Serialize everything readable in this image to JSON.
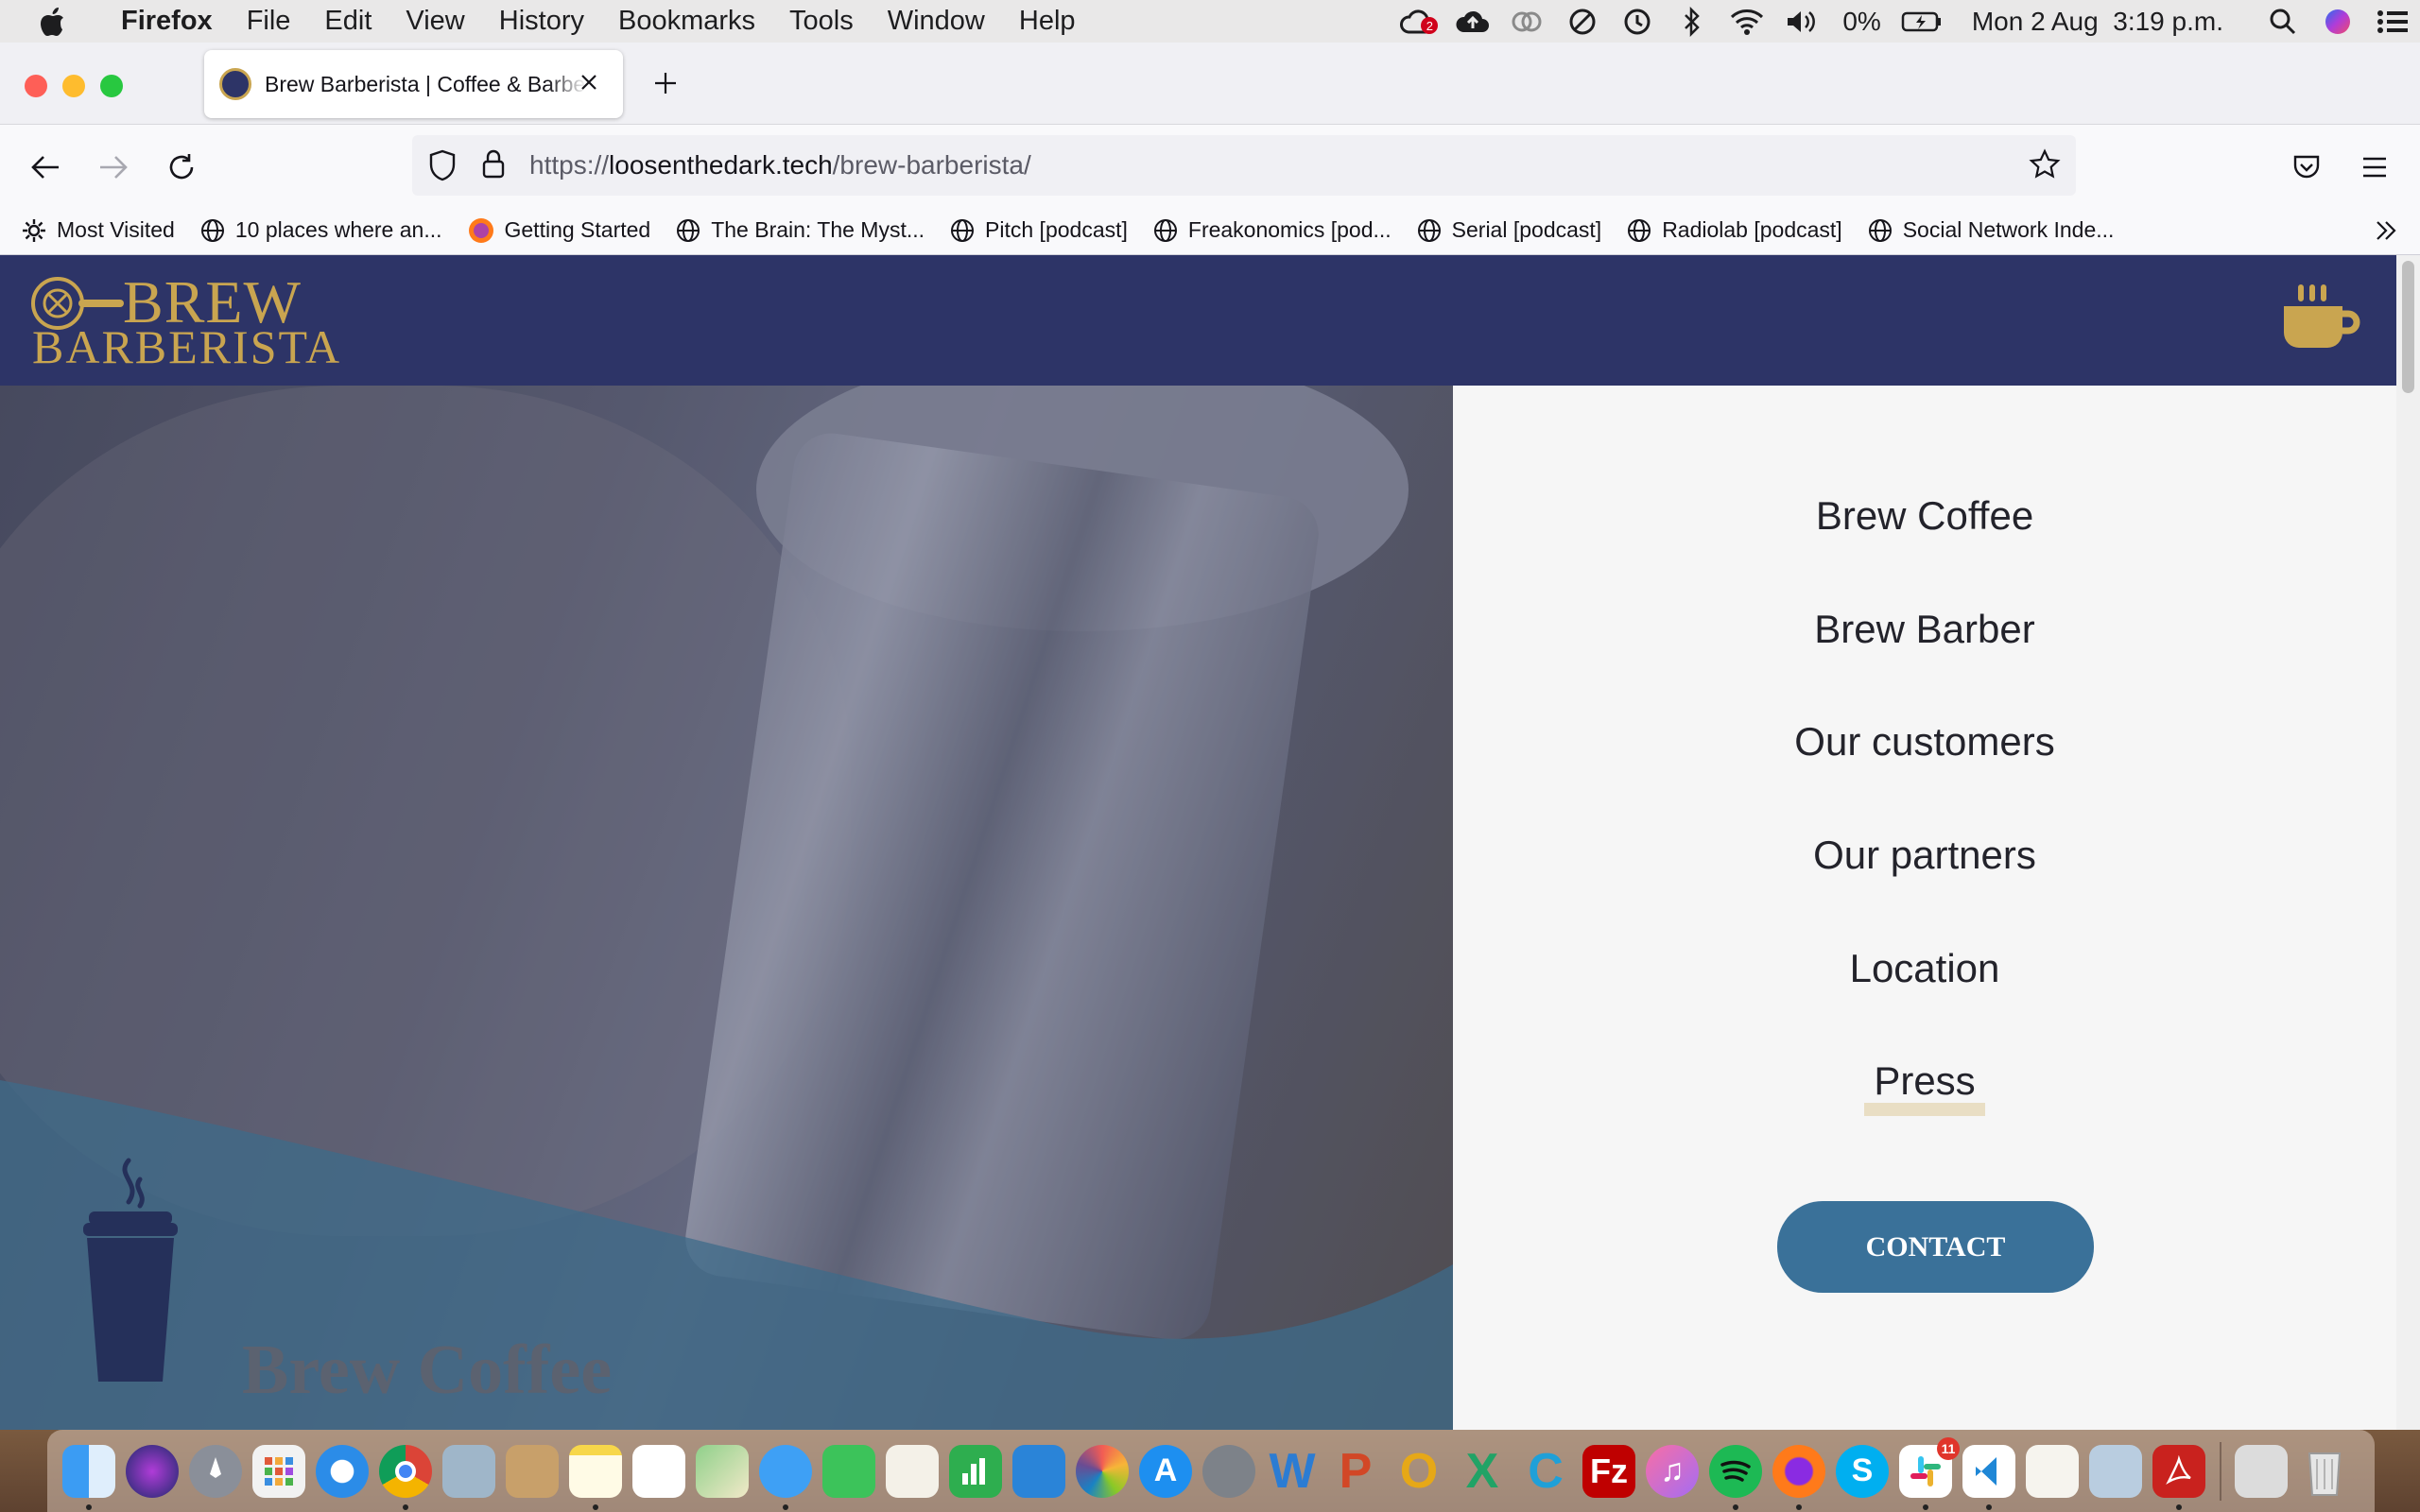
{
  "menubar": {
    "app_name": "Firefox",
    "items": [
      "File",
      "Edit",
      "View",
      "History",
      "Bookmarks",
      "Tools",
      "Window",
      "Help"
    ],
    "battery": "0%",
    "clock": "Mon 2 Aug  3:19 p.m.",
    "notification_count": "2"
  },
  "browser": {
    "tab_title": "Brew Barberista | Coffee & Barber",
    "url_prefix": "https://",
    "url_host": "loosenthedark.tech",
    "url_path": "/brew-barberista/",
    "bookmarks": [
      "Most Visited",
      "10 places where an...",
      "Getting Started",
      "The Brain: The Myst...",
      "Pitch [podcast]",
      "Freakonomics [pod...",
      "Serial [podcast]",
      "Radiolab [podcast]",
      "Social Network Inde..."
    ]
  },
  "site": {
    "logo_top": "BREW",
    "logo_bottom": "BARBERISTA",
    "hero_label": "Brew Coffee",
    "menu": [
      "Brew Coffee",
      "Brew Barber",
      "Our customers",
      "Our partners",
      "Location",
      "Press"
    ],
    "contact_label": "CONTACT"
  },
  "colors": {
    "navy": "#2d3467",
    "gold": "#c9a550",
    "contact_blue": "#3a7199"
  },
  "dock": {
    "badges": {
      "slack": "11"
    }
  }
}
